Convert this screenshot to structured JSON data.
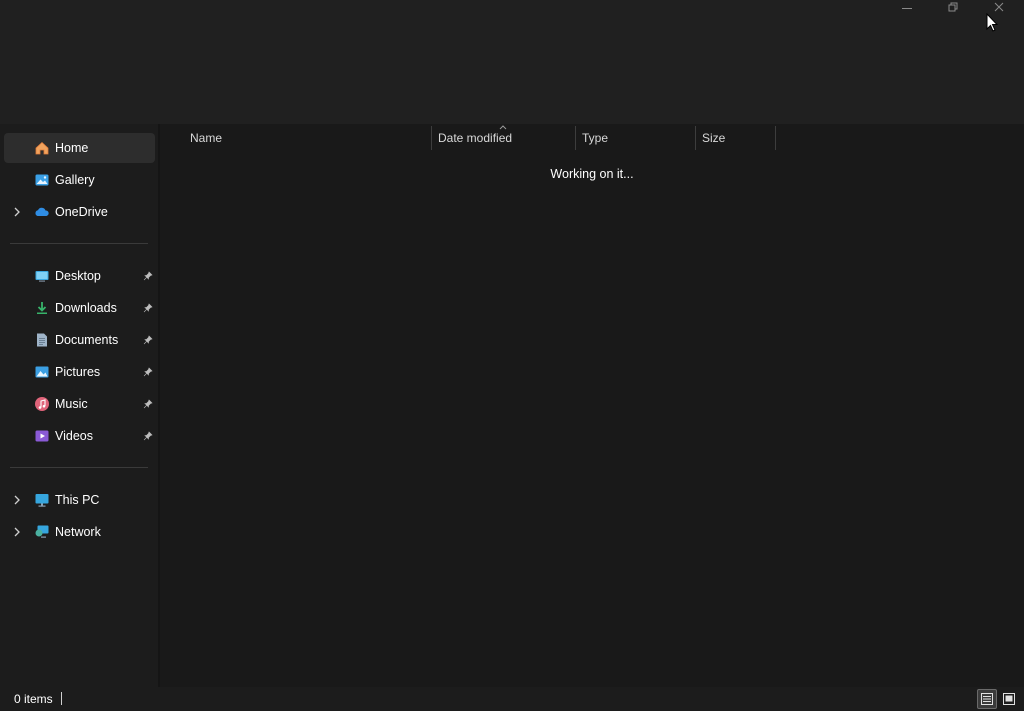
{
  "window": {
    "minimize_icon": "minimize-icon",
    "maximize_icon": "restore-icon",
    "close_icon": "close-icon"
  },
  "sidebar": {
    "quick": [
      {
        "label": "Home",
        "icon": "home-icon",
        "selected": true,
        "expandable": false
      },
      {
        "label": "Gallery",
        "icon": "gallery-icon",
        "selected": false,
        "expandable": false
      },
      {
        "label": "OneDrive",
        "icon": "onedrive-icon",
        "selected": false,
        "expandable": true
      }
    ],
    "pinned": [
      {
        "label": "Desktop",
        "icon": "desktop-icon",
        "pinned": true
      },
      {
        "label": "Downloads",
        "icon": "downloads-icon",
        "pinned": true
      },
      {
        "label": "Documents",
        "icon": "documents-icon",
        "pinned": true
      },
      {
        "label": "Pictures",
        "icon": "pictures-icon",
        "pinned": true
      },
      {
        "label": "Music",
        "icon": "music-icon",
        "pinned": true
      },
      {
        "label": "Videos",
        "icon": "videos-icon",
        "pinned": true
      }
    ],
    "locations": [
      {
        "label": "This PC",
        "icon": "this-pc-icon",
        "expandable": true
      },
      {
        "label": "Network",
        "icon": "network-icon",
        "expandable": true
      }
    ]
  },
  "columns": {
    "name": "Name",
    "date_modified": "Date modified",
    "type": "Type",
    "size": "Size"
  },
  "content": {
    "loading_text": "Working on it..."
  },
  "status": {
    "item_count": "0 items"
  },
  "colors": {
    "background": "#191919",
    "sidebar": "#1c1c1c",
    "selected": "#2d2d2d",
    "text": "#ffffff"
  }
}
